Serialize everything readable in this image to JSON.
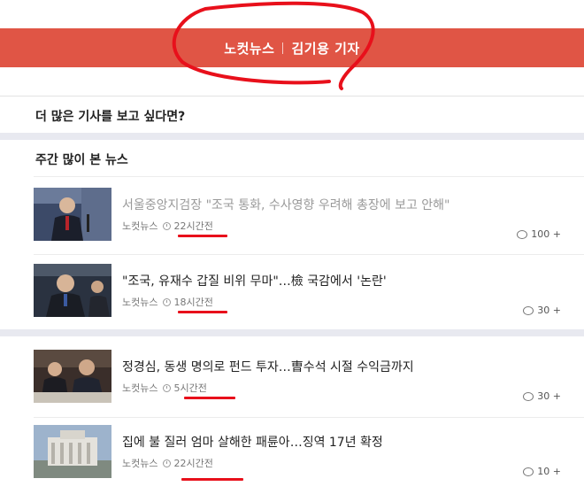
{
  "banner": {
    "outlet": "노컷뉴스",
    "reporter": "김기용 기자"
  },
  "more": {
    "title": "더 많은 기사를 보고 싶다면?"
  },
  "weekly": {
    "title": "주간 많이 본 뉴스"
  },
  "items": [
    {
      "headline": "서울중앙지검장 \"조국 통화, 수사영향 우려해 총장에 보고 안해\"",
      "source": "노컷뉴스",
      "time": "22시간전",
      "comments": "100 +"
    },
    {
      "headline": "\"조국, 유재수 갑질 비위 무마\"…檢 국감에서 '논란'",
      "source": "노컷뉴스",
      "time": "18시간전",
      "comments": "30 +"
    },
    {
      "headline": "정경심, 동생 명의로 펀드 투자…曺수석 시절 수익금까지",
      "source": "노컷뉴스",
      "time": "5시간전",
      "comments": "30 +"
    },
    {
      "headline": "집에 불 질러 엄마 살해한 패륜아…징역 17년 확정",
      "source": "노컷뉴스",
      "time": "22시간전",
      "comments": "10 +"
    }
  ],
  "colors": {
    "banner": "#e05545",
    "annotation": "#e8101b"
  }
}
